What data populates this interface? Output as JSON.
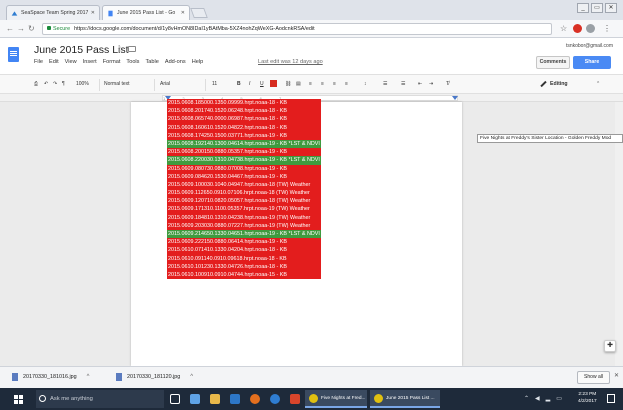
{
  "browser": {
    "tabs": [
      {
        "label": "SeaSpace Team Spring 2017"
      },
      {
        "label": "June 2015 Pass List - Go"
      }
    ],
    "url_secure": "Secure",
    "url": "https://docs.google.com/document/d/1y8vHmON8IDaI1yBAtMba-5XZ4nohZqWeXG-AodcnkRSA/edit",
    "window_controls": [
      "_",
      "▭",
      "✕"
    ]
  },
  "docs": {
    "title": "June 2015 Pass List",
    "menu": [
      "File",
      "Edit",
      "View",
      "Insert",
      "Format",
      "Tools",
      "Table",
      "Add-ons",
      "Help"
    ],
    "last_edit": "Last edit was 12 days ago",
    "email": "tsnkobor@gmail.com",
    "comments_label": "Comments",
    "share_label": "Share",
    "mode_label": "Editing"
  },
  "toolbar": {
    "zoom": "100%",
    "style": "Normal text",
    "font": "Arial",
    "size": "11",
    "bold": "B",
    "italic": "I",
    "underline": "U",
    "text_color": "#d62b1f"
  },
  "ruler": {
    "ticks": "1 2 3 4 5 6 7"
  },
  "document": {
    "lines": [
      {
        "text": "2015.0608.185000.1350.09999.hrpt.noaa-18 - KB",
        "highlight": "red"
      },
      {
        "text": "2015.0608.201740.1520.06248.hrpt.noaa-18 - KB",
        "highlight": "red"
      },
      {
        "text": "2015.0608.065740.0000.06987.hrpt.noaa-18 - KB",
        "highlight": "red"
      },
      {
        "text": "2015.0608.160610.1520.04822.hrpt.noaa-18 - KB",
        "highlight": "red"
      },
      {
        "text": "2015.0608.174250.1500.03771.hrpt.noaa-19 - KB",
        "highlight": "red"
      },
      {
        "text": "2015.0608.192140.1300.04614.hrpt.noaa-19 - KB *LST & NDVI",
        "highlight": "green"
      },
      {
        "text": "2015.0608.200150.0880.05357.hrpt.noaa-19 - KB",
        "highlight": "red"
      },
      {
        "text": "2015.0608.220030.1310.04738.hrpt.noaa-19 - KB *LST & NDVI",
        "highlight": "green"
      },
      {
        "text": "2015.0609.080730.0880.07008.hrpt.noaa-19 - KB",
        "highlight": "red"
      },
      {
        "text": "2015.0609.084620.1530.04467.hrpt.noaa-19 - KB",
        "highlight": "red"
      },
      {
        "text": "2015.0609.100030.1040.04947.hrpt.noaa-18 (TW) Weather",
        "highlight": "red"
      },
      {
        "text": "2015.0609.112650.0910.07106.hrpt.noaa-18 (TW) Weather",
        "highlight": "red"
      },
      {
        "text": "2015.0609.120710.0820.05057.hrpt.noaa-18 (TW) Weather",
        "highlight": "red"
      },
      {
        "text": "2015.0609.171310.1100.05357.hrpt.noaa-19 (TW) Weather",
        "highlight": "red"
      },
      {
        "text": "2015.0609.184810.1310.04238.hrpt.noaa-19 (TW) Weather",
        "highlight": "red"
      },
      {
        "text": "2015.0609.203030.0880.07227.hrpt.noaa-19 (TW) Weather",
        "highlight": "red"
      },
      {
        "text": "2015.0609.214650.1330.04651.hrpt.noaa-19 - KB *LST & NDVI",
        "highlight": "green"
      },
      {
        "text": "2015.0609.222150.0880.06414.hrpt.noaa-19 - KB",
        "highlight": "red"
      },
      {
        "text": "2015.0610.071410.1330.04204.hrpt.noaa-18 - KB",
        "highlight": "red"
      },
      {
        "text": "2015.0610.091140.0910.09618.hrpt.noaa-18 - KB",
        "highlight": "red"
      },
      {
        "text": "2015.0610.101230.1330.04726.hrpt.noaa-18 - KB",
        "highlight": "red"
      },
      {
        "text": "2015.0610.100910.0910.04744.hrpt.noaa-15 - KB",
        "highlight": "red"
      }
    ],
    "tooltip": "Five Nights at Freddy's Sister Location - Golden Freddy Mod"
  },
  "downloads": {
    "items": [
      {
        "name": "20170330_181016.jpg"
      },
      {
        "name": "20170330_181120.jpg"
      }
    ],
    "show_all": "Show all"
  },
  "taskbar": {
    "search_placeholder": "Ask me anything",
    "apps": [
      {
        "label": "Five Nights at Fred..."
      },
      {
        "label": "June 2015 Pass List ..."
      }
    ],
    "time": "2:23 PM",
    "date": "4/2/2017"
  }
}
